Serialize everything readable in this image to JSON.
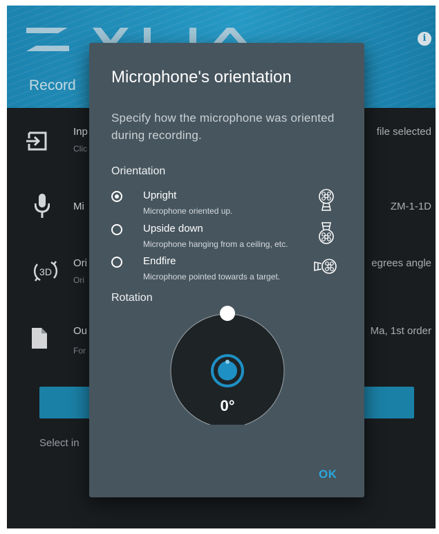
{
  "app": {
    "logo_text": "ZYLIA",
    "header_title": "Record",
    "info_icon": "info-icon",
    "colors": {
      "header": "#1f8fbe",
      "background": "#1c2023",
      "dialog": "#47555e",
      "accent": "#29a7dc"
    }
  },
  "rows": [
    {
      "icon": "input-icon",
      "title": "Inp",
      "subtitle": "Clic",
      "value": "file selected"
    },
    {
      "icon": "microphone-icon",
      "title": "Mi",
      "subtitle": "",
      "value": "ZM-1-1D"
    },
    {
      "icon": "3d-rotate-icon",
      "title": "Ori",
      "subtitle": "Ori",
      "value": "egrees angle"
    },
    {
      "icon": "file-icon",
      "title": "Ou",
      "subtitle": "For",
      "value": "Ma, 1st order"
    }
  ],
  "bottom_hint": "Select in",
  "dialog": {
    "title": "Microphone's orientation",
    "description": "Specify how the microphone was oriented during recording.",
    "orientation_label": "Orientation",
    "options": [
      {
        "label": "Upright",
        "description": "Microphone oriented up.",
        "selected": true,
        "icon": "mic-upright-icon"
      },
      {
        "label": "Upside down",
        "description": "Microphone hanging from a ceiling, etc.",
        "selected": false,
        "icon": "mic-upside-down-icon"
      },
      {
        "label": "Endfire",
        "description": "Microphone pointed towards a target.",
        "selected": false,
        "icon": "mic-endfire-icon"
      }
    ],
    "rotation_label": "Rotation",
    "rotation_value": "0°",
    "ok_label": "OK"
  }
}
